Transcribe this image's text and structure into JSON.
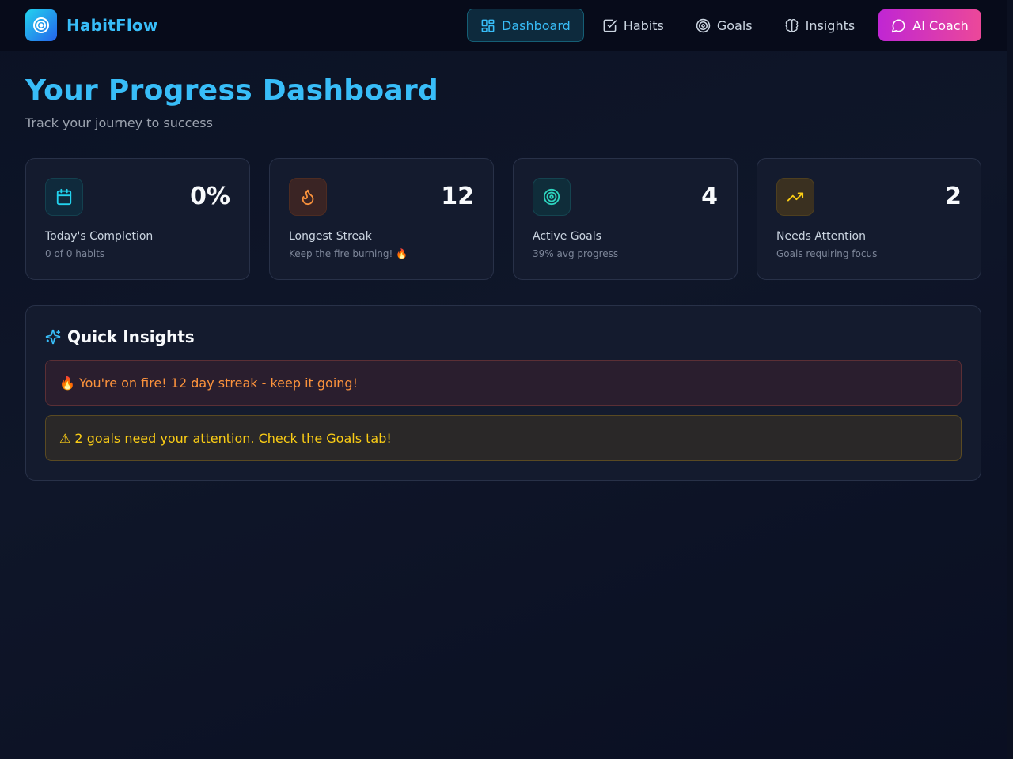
{
  "header": {
    "brand": "HabitFlow",
    "nav": [
      {
        "label": "Dashboard",
        "icon": "layout-grid-icon",
        "active": true
      },
      {
        "label": "Habits",
        "icon": "check-square-icon",
        "active": false
      },
      {
        "label": "Goals",
        "icon": "target-icon",
        "active": false
      },
      {
        "label": "Insights",
        "icon": "brain-icon",
        "active": false
      }
    ],
    "coach_label": "AI Coach"
  },
  "page": {
    "title": "Your Progress Dashboard",
    "subtitle": "Track your journey to success"
  },
  "stats": [
    {
      "value": "0%",
      "label": "Today's Completion",
      "sub": "0 of 0 habits",
      "icon": "calendar-icon",
      "color": "#22d3ee"
    },
    {
      "value": "12",
      "label": "Longest Streak",
      "sub": "Keep the fire burning! 🔥",
      "icon": "flame-icon",
      "color": "#fb923c"
    },
    {
      "value": "4",
      "label": "Active Goals",
      "sub": "39% avg progress",
      "icon": "target-icon",
      "color": "#2dd4bf"
    },
    {
      "value": "2",
      "label": "Needs Attention",
      "sub": "Goals requiring focus",
      "icon": "trending-up-icon",
      "color": "#facc15"
    }
  ],
  "insights": {
    "title": "Quick Insights",
    "items": [
      {
        "text": "🔥 You're on fire! 12 day streak - keep it going!",
        "kind": "fire"
      },
      {
        "text": "⚠ 2 goals need your attention. Check the Goals tab!",
        "kind": "warn"
      }
    ]
  },
  "colors": {
    "accent": "#38bdf8",
    "coach_gradient_start": "#c026d3",
    "coach_gradient_end": "#ec4899"
  }
}
